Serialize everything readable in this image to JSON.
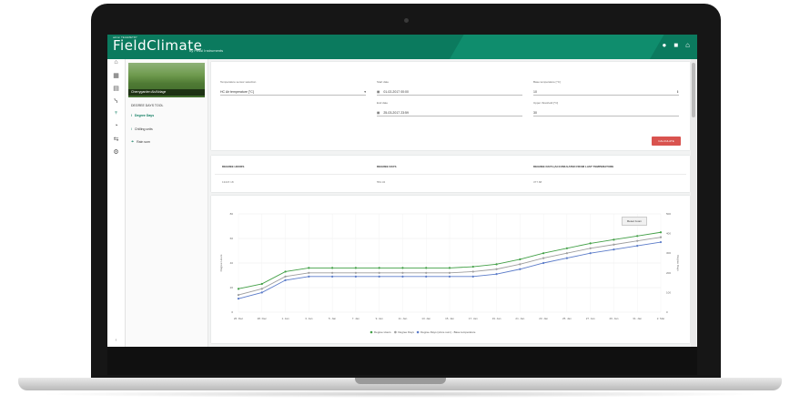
{
  "app": {
    "brand_top": "adcon TELEMETRY",
    "brand_name": "FieldClimate",
    "brand_sub": "by Pessl Instruments",
    "header_icons": [
      "user-icon",
      "folder-icon",
      "home-icon"
    ]
  },
  "rail_icons": [
    "home-icon",
    "grid-icon",
    "station-icon",
    "chart-icon",
    "leaf-icon",
    "sensor-icon",
    "arrows-icon",
    "gear-icon"
  ],
  "rail_bottom": "‹",
  "sidebar": {
    "station_label": "Cherrygarden Ab/Ablage",
    "heading": "DEGREE DAYS TOOL",
    "items": [
      {
        "label": "Degree Days",
        "icon": "thermometer-icon",
        "active": true
      },
      {
        "label": "Chilling units",
        "icon": "thermometer-icon",
        "active": false
      },
      {
        "label": "Rain sum",
        "icon": "rain-icon",
        "active": false
      }
    ]
  },
  "form": {
    "temp_label": "Temperature sensor selection",
    "temp_value": "HC Air temperature [°C]",
    "start_label": "Start date",
    "start_value": "01-02-2017 00:00",
    "end_label": "End date",
    "end_value": "25-03-2017 23:59",
    "base_label": "Base temperature [°C]",
    "base_value": "10",
    "upper_label": "Upper threshold [°C]",
    "upper_value": "30",
    "calc_button": "CALCULATE"
  },
  "summary_table": {
    "headers": [
      "DEGREE HOURS",
      "DEGREE DAYS",
      "DEGREE DAYS (ACCUMULATED FROM LAST TEMPERATURE"
    ],
    "values": [
      "13447.18",
      "554.34",
      "377.68"
    ]
  },
  "chart": {
    "reset_label": "Reset zoom",
    "y_left_label": "Degree Hours",
    "y_right_label": "Degree Days"
  },
  "chart_data": {
    "type": "line",
    "categories": [
      "26. Dec",
      "28. Dec",
      "1. Jan",
      "3. Jan",
      "5. Jan",
      "7. Jan",
      "9. Jan",
      "11. Jan",
      "13. Jan",
      "15. Jan",
      "17. Jan",
      "19. Jan",
      "21. Jan",
      "23. Jan",
      "25. Jan",
      "27. Jan",
      "29. Jan",
      "31. Jan",
      "2. Mar"
    ],
    "yticks_left": [
      0,
      20,
      40,
      60,
      80
    ],
    "yticks_right": [
      0,
      100,
      200,
      300,
      400,
      500
    ],
    "ylim": [
      0,
      80
    ],
    "series": [
      {
        "name": "Degree Hours",
        "color": "#43a047",
        "values": [
          19,
          23,
          33,
          36,
          36,
          36,
          36,
          36,
          36,
          36,
          37,
          39,
          43,
          48,
          52,
          56,
          59,
          62,
          65
        ]
      },
      {
        "name": "Degree Days",
        "color": "#9e9e9e",
        "values": [
          14,
          19,
          29,
          32,
          32,
          32,
          32,
          32,
          32,
          32,
          33,
          35,
          39,
          44,
          48,
          52,
          55,
          58,
          61
        ]
      },
      {
        "name": "Degree Days (since sum) - Base temperature",
        "color": "#5c7cc9",
        "values": [
          11,
          16,
          26,
          29,
          29,
          29,
          29,
          29,
          29,
          29,
          29,
          31,
          35,
          40,
          44,
          48,
          51,
          54,
          57
        ]
      }
    ],
    "legend": "bottom",
    "grid": true
  }
}
